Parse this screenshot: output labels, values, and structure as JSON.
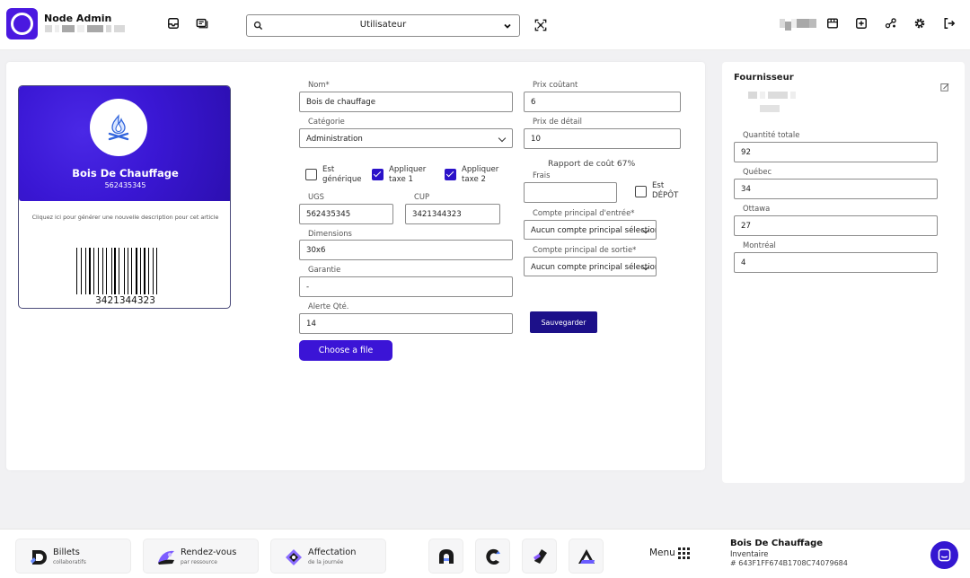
{
  "app": {
    "title": "Node Admin"
  },
  "search": {
    "selected": "Utilisateur"
  },
  "product": {
    "name": "Bois De Chauffage",
    "code": "562435345",
    "hint": "Cliquez ici pour générer une nouvelle description pour cet article",
    "barcode": "3421344323"
  },
  "form": {
    "nom": {
      "label": "Nom*",
      "value": "Bois de chauffage"
    },
    "categorie": {
      "label": "Catégorie",
      "value": "Administration"
    },
    "est_generique": {
      "label": "Est générique",
      "checked": false
    },
    "taxe1": {
      "label": "Appliquer taxe 1",
      "checked": true
    },
    "taxe2": {
      "label": "Appliquer taxe 2",
      "checked": true
    },
    "ugs": {
      "label": "UGS",
      "value": "562435345"
    },
    "cup": {
      "label": "CUP",
      "value": "3421344323"
    },
    "dimensions": {
      "label": "Dimensions",
      "value": "30x6"
    },
    "garantie": {
      "label": "Garantie",
      "value": "-"
    },
    "alerte": {
      "label": "Alerte Qté.",
      "value": "14"
    },
    "prix_coutant": {
      "label": "Prix coûtant",
      "value": "6"
    },
    "prix_detail": {
      "label": "Prix de détail",
      "value": "10"
    },
    "rapport": "Rapport de coût 67%",
    "frais": {
      "label": "Frais",
      "value": ""
    },
    "est_depot": {
      "label": "Est DÉPÔT",
      "checked": false
    },
    "compte_entree": {
      "label": "Compte principal d'entrée*",
      "value": "Aucun compte principal sélectionné"
    },
    "compte_sortie": {
      "label": "Compte principal de sortie*",
      "value": "Aucun compte principal sélectionné"
    },
    "save": "Sauvegarder",
    "file": "Choose a file"
  },
  "supplier": {
    "title": "Fournisseur",
    "quantities": [
      {
        "label": "Quantité totale",
        "value": "92"
      },
      {
        "label": "Québec",
        "value": "34"
      },
      {
        "label": "Ottawa",
        "value": "27"
      },
      {
        "label": "Montréal",
        "value": "4"
      }
    ]
  },
  "bottom": {
    "apps": [
      {
        "title": "Billets",
        "subtitle": "collaboratifs"
      },
      {
        "title": "Rendez-vous",
        "subtitle": "par ressource"
      },
      {
        "title": "Affectation",
        "subtitle": "de la journée"
      }
    ],
    "menu": "Menu",
    "footer": {
      "name": "Bois De Chauffage",
      "section": "Inventaire",
      "id": "# 643F1FF674B1708C74079684"
    }
  },
  "colors": {
    "primary": "#3b14d6",
    "dark": "#1c1089",
    "accent": "#4a18e0"
  }
}
